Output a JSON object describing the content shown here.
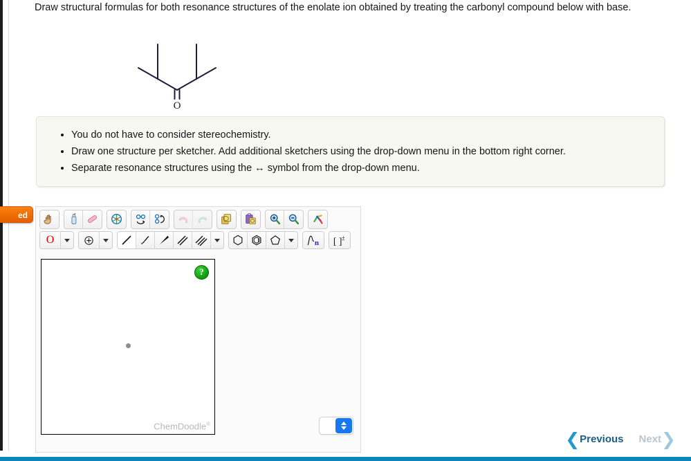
{
  "question": {
    "text": "Draw structural formulas for both resonance structures of the enolate ion obtained by treating the carbonyl compound below with base."
  },
  "molecule": {
    "name": "2,4-dimethyl-3-pentanone",
    "oxygen_label": "O",
    "bond_color": "#201a3a"
  },
  "instructions": {
    "bullets": [
      "You do not have to consider stereochemistry.",
      "Draw one structure per sketcher. Add additional sketchers using the drop-down menu in the bottom right corner.",
      "Separate resonance structures using the ↔ symbol from the drop-down menu."
    ]
  },
  "feedback_tab": {
    "label": "ed"
  },
  "sketcher": {
    "toolbar_row1": [
      {
        "name": "hand-pan-icon",
        "title": "Move / Pan",
        "group": 0
      },
      {
        "name": "lasso-erase-icon",
        "title": "Erase",
        "group": 1
      },
      {
        "name": "eraser-icon",
        "title": "Eraser",
        "group": 1
      },
      {
        "name": "clean-structure-icon",
        "title": "Clean Structure",
        "group": 2
      },
      {
        "name": "flip-horizontal-icon",
        "title": "Flip Horizontal",
        "group": 3
      },
      {
        "name": "flip-vertical-icon",
        "title": "Flip Vertical",
        "group": 3
      },
      {
        "name": "undo-icon",
        "title": "Undo",
        "group": 4
      },
      {
        "name": "redo-icon",
        "title": "Redo",
        "group": 4
      },
      {
        "name": "copy-icon",
        "title": "Copy",
        "group": 5
      },
      {
        "name": "paste-icon",
        "title": "Paste",
        "group": 6
      },
      {
        "name": "zoom-in-icon",
        "title": "Zoom In",
        "group": 7
      },
      {
        "name": "zoom-out-icon",
        "title": "Zoom Out",
        "group": 7
      },
      {
        "name": "template-icon",
        "title": "Templates",
        "group": 8
      }
    ],
    "toolbar_row2": {
      "element_label": "O",
      "element_color": "#e00000",
      "charge_icon": "plus-circle-icon",
      "bond_tools": [
        {
          "name": "single-bond-icon",
          "active": true
        },
        {
          "name": "hash-wedge-bond-icon",
          "active": false
        },
        {
          "name": "wedge-bond-icon",
          "active": false
        },
        {
          "name": "double-bond-icon",
          "active": false
        },
        {
          "name": "triple-bond-icon",
          "active": false
        }
      ],
      "ring_tools": [
        {
          "name": "benzene-ring-icon"
        },
        {
          "name": "aromatic-ring-icon"
        },
        {
          "name": "cyclopentane-ring-icon"
        }
      ],
      "repeat-unit": "n",
      "bracket_label": "[ ]±"
    },
    "canvas": {
      "help_badge": "?",
      "watermark": "ChemDoodle",
      "watermark_sup": "®",
      "atom_dot": "carbon-atom-dot"
    },
    "select_value": ""
  },
  "navigation": {
    "previous_label": "Previous",
    "next_label": "Next",
    "previous_chevron": "❮",
    "next_chevron": "❯",
    "previous_color": "#1a5d86",
    "next_color": "#b9c6cd"
  },
  "colors": {
    "accent_blue": "#0e84bd",
    "tab_orange": "#f06c00",
    "select_blue": "#1878f0",
    "instruction_bg": "#f8f8f3"
  }
}
